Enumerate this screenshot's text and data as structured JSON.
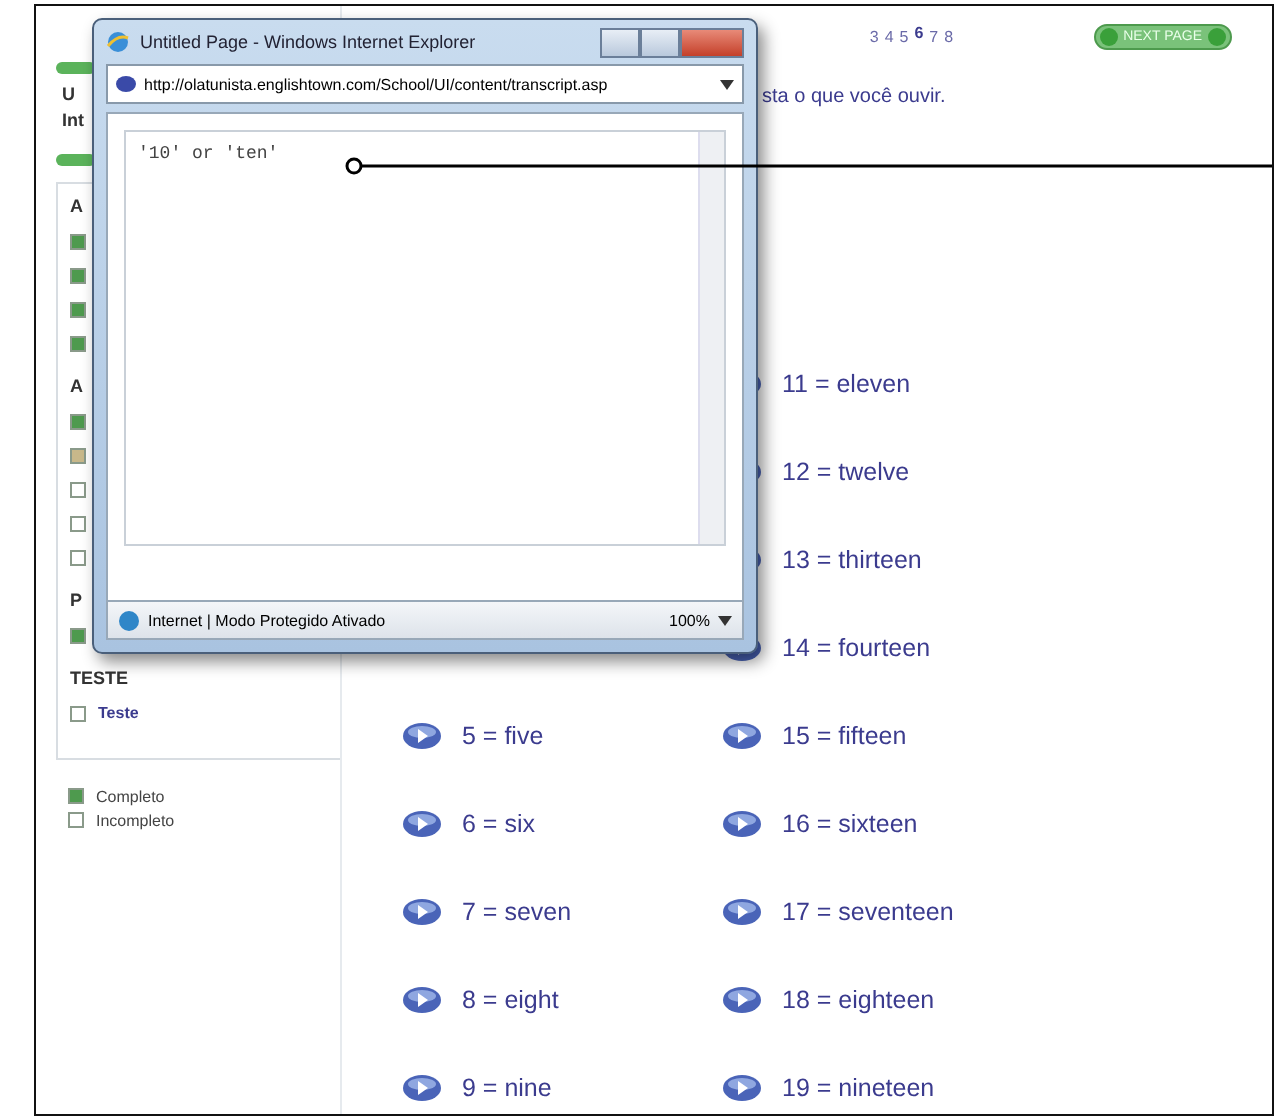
{
  "sidebar": {
    "card": [
      "U",
      "Int"
    ],
    "groups": [
      {
        "heading": "A",
        "items": [
          {
            "color": "#4e9a4e"
          },
          {
            "color": "#4e9a4e"
          },
          {
            "color": "#4e9a4e"
          },
          {
            "color": "#4e9a4e"
          }
        ]
      },
      {
        "heading": "A",
        "items": [
          {
            "color": "#4e9a4e"
          },
          {
            "color": "#c8b88a"
          },
          {
            "color": "#ffffff"
          },
          {
            "color": "#ffffff"
          },
          {
            "color": "#ffffff"
          }
        ]
      },
      {
        "heading": "P",
        "items": [
          {
            "color": "#4e9a4e"
          }
        ]
      },
      {
        "heading": "TESTE",
        "items": [
          {
            "color": "#ffffff",
            "label": "Teste"
          }
        ]
      }
    ],
    "legend": [
      {
        "color": "#4e9a4e",
        "label": "Completo"
      },
      {
        "color": "#ffffff",
        "label": "Incompleto"
      }
    ]
  },
  "pagination": [
    {
      "label": "3",
      "selected": false
    },
    {
      "label": "4",
      "selected": false
    },
    {
      "label": "5",
      "selected": false
    },
    {
      "label": "6",
      "selected": true
    },
    {
      "label": "7",
      "selected": false
    },
    {
      "label": "8",
      "selected": false
    }
  ],
  "next_button": "NEXT PAGE",
  "instruction": "sta o que você ouvir.",
  "numbers": [
    {
      "right": "11 = eleven"
    },
    {
      "right": "12 = twelve"
    },
    {
      "right": "13 = thirteen"
    },
    {
      "right": "14 = fourteen"
    },
    {
      "left": "5 = five",
      "right": "15 = fifteen"
    },
    {
      "left": "6 = six",
      "right": "16 = sixteen"
    },
    {
      "left": "7 = seven",
      "right": "17 = seventeen"
    },
    {
      "left": "8 = eight",
      "right": "18 = eighteen"
    },
    {
      "left": "9 = nine",
      "right": "19 = nineteen"
    }
  ],
  "popup": {
    "title": "Untitled Page - Windows Internet Explorer",
    "address": "http://olatunista.englishtown.com/School/UI/content/transcript.asp",
    "content": "'10' or 'ten'",
    "status": "Internet | Modo Protegido Ativado",
    "zoom": "100%"
  }
}
